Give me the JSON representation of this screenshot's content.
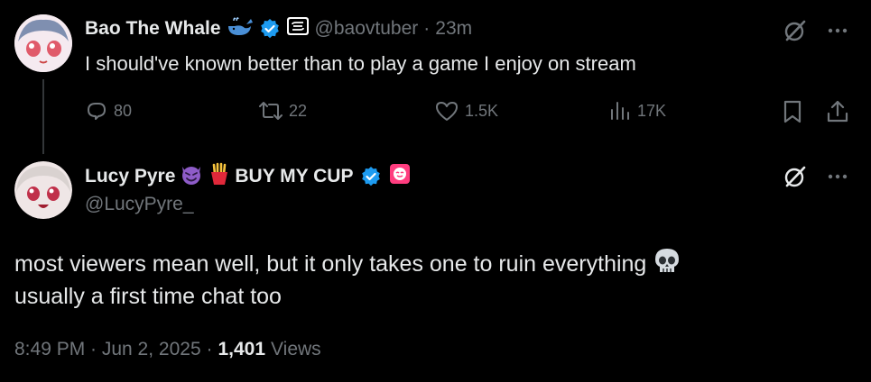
{
  "reply_to": {
    "display_name": "Bao The Whale",
    "handle": "@baovtuber",
    "separator": "·",
    "time": "23m",
    "text": "I should've known better than to play a game I enjoy on stream",
    "actions": {
      "replies": "80",
      "reposts": "22",
      "likes": "1.5K",
      "views": "17K"
    },
    "icons": [
      "whale-emoji",
      "verified-badge",
      "affiliate-badge",
      "grok-icon",
      "more-icon",
      "reply-icon",
      "repost-icon",
      "like-icon",
      "views-icon",
      "bookmark-icon",
      "share-icon"
    ]
  },
  "main_post": {
    "display_name_part1": "Lucy Pyre",
    "display_name_part2": "BUY MY CUP",
    "handle": "@LucyPyre_",
    "text_line1": "most viewers mean well, but it only takes one to ruin everything",
    "text_line2": "usually a first time chat too",
    "timestamp": "8:49 PM · Jun 2, 2025 ·",
    "views_count": "1,401",
    "views_label": "Views",
    "icons": [
      "devil-emoji",
      "fries-emoji",
      "verified-badge",
      "affiliate-badge",
      "skull-emoji",
      "grok-icon",
      "more-icon"
    ]
  },
  "colors": {
    "background": "#000000",
    "text_primary": "#e7e9ea",
    "text_secondary": "#71767b",
    "verified_blue": "#1d9bf0",
    "thread_line": "#333639"
  }
}
